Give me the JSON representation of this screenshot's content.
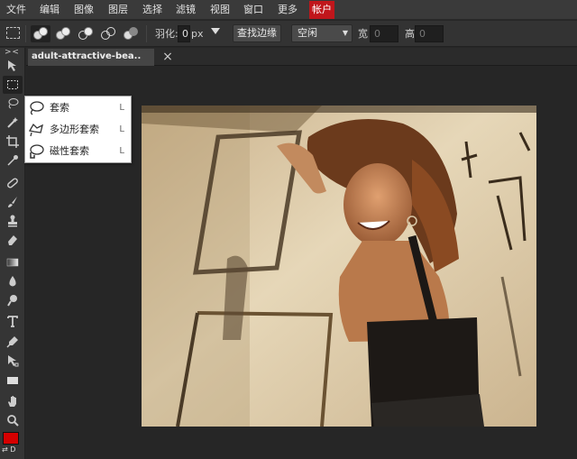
{
  "menu": {
    "items": [
      "文件",
      "编辑",
      "图像",
      "图层",
      "选择",
      "滤镜",
      "视图",
      "窗口",
      "更多",
      "帐户"
    ],
    "active_index": 9
  },
  "options": {
    "feather_label": "羽化:",
    "feather_value": "0",
    "feather_unit": "px",
    "find_edges_label": "查找边缘",
    "style_value": "空闲",
    "width_label": "宽",
    "width_value": "0",
    "height_label": "高",
    "height_value": "0"
  },
  "toolbar": {
    "collapse_label": "> <",
    "tools": [
      "move-tool-icon",
      "marquee-tool-icon",
      "lasso-tool-icon",
      "magic-wand-tool-icon",
      "crop-tool-icon",
      "eyedropper-tool-icon",
      "healing-tool-icon",
      "brush-tool-icon",
      "stamp-tool-icon",
      "eraser-tool-icon",
      "gradient-tool-icon",
      "blur-tool-icon",
      "dodge-tool-icon",
      "type-tool-icon",
      "pen-tool-icon",
      "path-select-tool-icon",
      "shape-tool-icon",
      "hand-tool-icon",
      "zoom-tool-icon"
    ],
    "foreground_color": "#d50000",
    "swap_label": "⇄ D"
  },
  "document": {
    "tab_title": "adult-attractive-bea..",
    "close_symbol": "×"
  },
  "flyout": {
    "items": [
      {
        "name": "套索",
        "key": "L",
        "icon": "lasso-icon"
      },
      {
        "name": "多边形套索",
        "key": "L",
        "icon": "polygonal-lasso-icon"
      },
      {
        "name": "磁性套索",
        "key": "L",
        "icon": "magnetic-lasso-icon"
      }
    ]
  },
  "colors": {
    "accent": "#c0161b",
    "menubar": "#3a3a3a",
    "panel": "#333333",
    "workspace": "#262626"
  }
}
